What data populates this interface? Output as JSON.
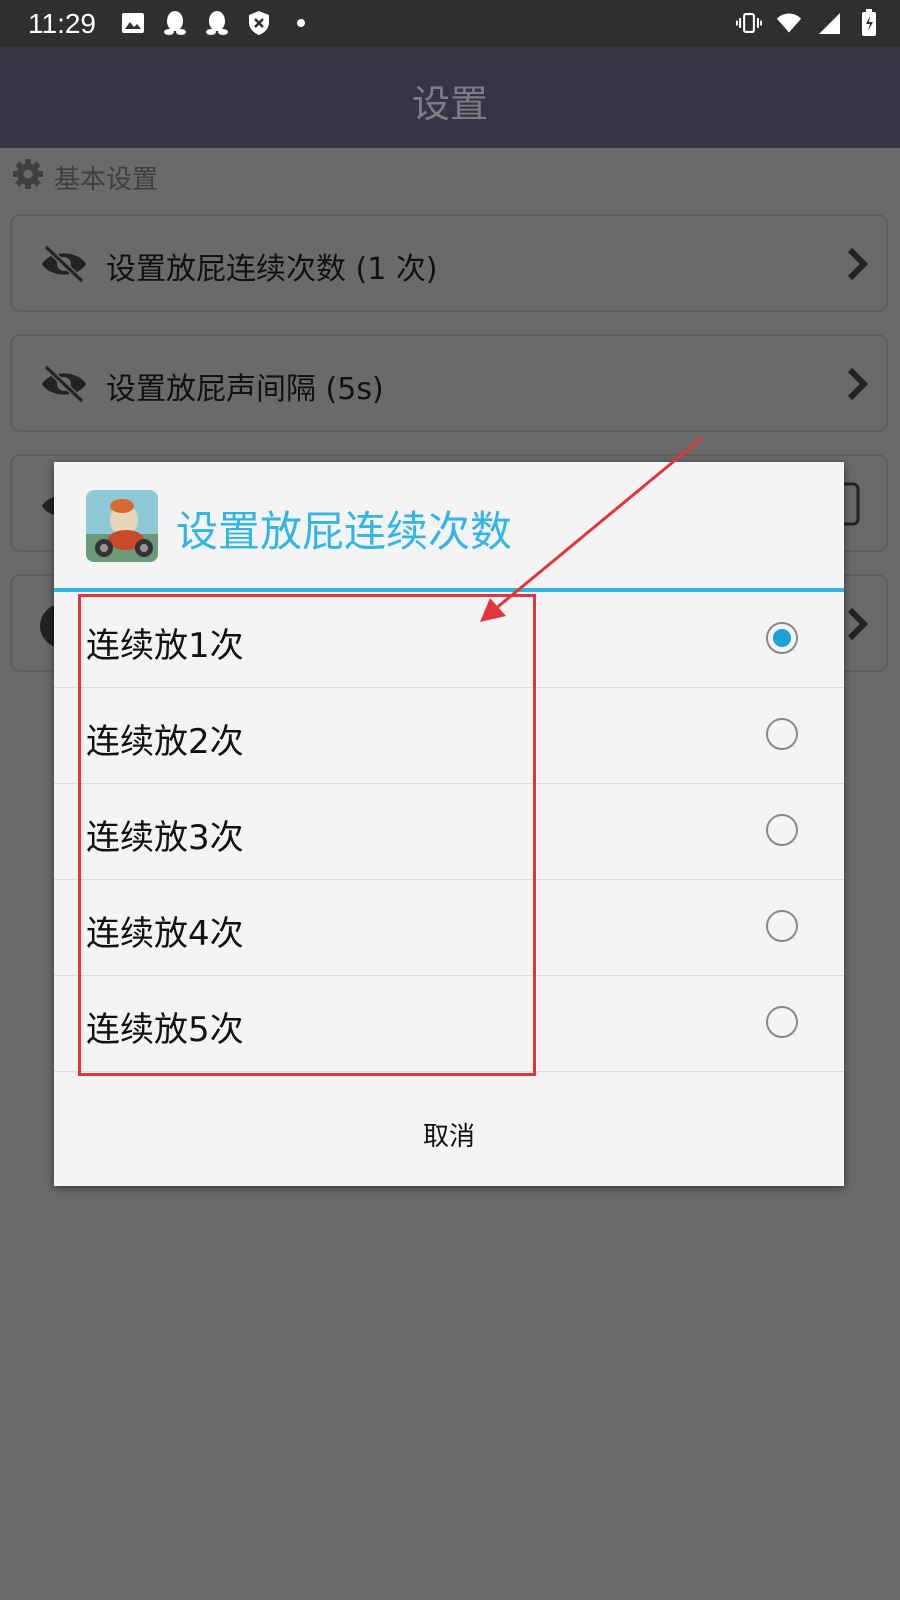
{
  "status_bar": {
    "time": "11:29",
    "left_icons": [
      "image-icon",
      "qq-icon",
      "qq-icon",
      "shield-x-icon",
      "dot-icon"
    ],
    "right_icons": [
      "vibrate-icon",
      "wifi-icon",
      "signal-icon",
      "battery-icon"
    ]
  },
  "appbar": {
    "title": "设置"
  },
  "content": {
    "section_title": "基本设置",
    "cards": [
      {
        "label": "设置放屁连续次数 (1 次)"
      },
      {
        "label": "设置放屁声间隔 (5s)"
      }
    ]
  },
  "dialog": {
    "title": "设置放屁连续次数",
    "options": [
      {
        "label": "连续放1次",
        "selected": true
      },
      {
        "label": "连续放2次",
        "selected": false
      },
      {
        "label": "连续放3次",
        "selected": false
      },
      {
        "label": "连续放4次",
        "selected": false
      },
      {
        "label": "连续放5次",
        "selected": false
      }
    ],
    "cancel_label": "取消"
  },
  "colors": {
    "accent": "#33b5e5",
    "radio_selected": "#1ea0d8",
    "annotation": "#e0353c"
  }
}
